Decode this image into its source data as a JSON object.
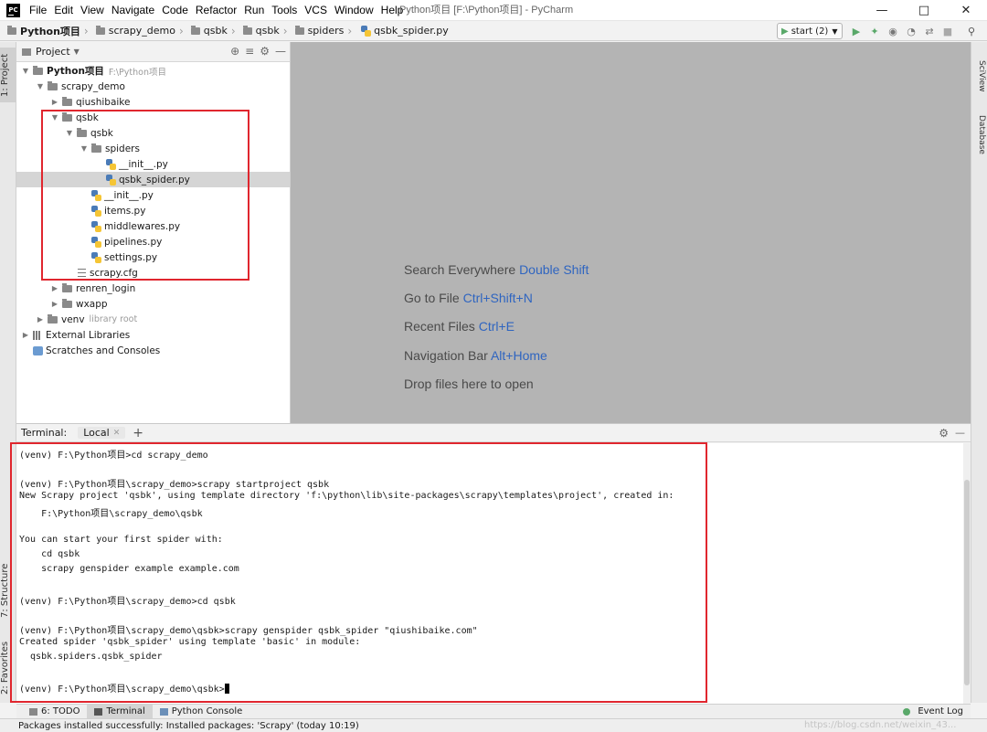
{
  "titlebar": {
    "app_icon": "PC",
    "menu": [
      "File",
      "Edit",
      "View",
      "Navigate",
      "Code",
      "Refactor",
      "Run",
      "Tools",
      "VCS",
      "Window",
      "Help"
    ],
    "title": "Python项目 [F:\\Python项目] - PyCharm",
    "controls": [
      "minimize-icon",
      "maximize-icon",
      "close-icon"
    ]
  },
  "navbar": {
    "breadcrumbs": [
      "Python项目",
      "scrapy_demo",
      "qsbk",
      "qsbk",
      "spiders",
      "qsbk_spider.py"
    ],
    "run_config": "start (2)",
    "run_icons": [
      "run-icon",
      "debug-icon",
      "coverage-icon",
      "profile-icon",
      "concurrency-icon",
      "stop-icon",
      "search-icon"
    ]
  },
  "left_strip": {
    "project_tab": "1: Project",
    "structure_tab": "7: Structure",
    "favorites_tab": "2: Favorites"
  },
  "right_strip": {
    "sciview_tab": "SciView",
    "database_tab": "Database"
  },
  "project_panel": {
    "header": "Project",
    "tree": [
      {
        "name": "Python项目",
        "note": "F:\\Python项目",
        "indent": 0,
        "type": "folder",
        "arrow": "down",
        "bold": true
      },
      {
        "name": "scrapy_demo",
        "indent": 1,
        "type": "folder",
        "arrow": "down"
      },
      {
        "name": "qiushibaike",
        "indent": 2,
        "type": "folder",
        "arrow": "right"
      },
      {
        "name": "qsbk",
        "indent": 2,
        "type": "folder",
        "arrow": "down"
      },
      {
        "name": "qsbk",
        "indent": 3,
        "type": "folder",
        "arrow": "down"
      },
      {
        "name": "spiders",
        "indent": 4,
        "type": "folder",
        "arrow": "down"
      },
      {
        "name": "__init__.py",
        "indent": 5,
        "type": "py"
      },
      {
        "name": "qsbk_spider.py",
        "indent": 5,
        "type": "py",
        "selected": true
      },
      {
        "name": "__init__.py",
        "indent": 4,
        "type": "py"
      },
      {
        "name": "items.py",
        "indent": 4,
        "type": "py"
      },
      {
        "name": "middlewares.py",
        "indent": 4,
        "type": "py"
      },
      {
        "name": "pipelines.py",
        "indent": 4,
        "type": "py"
      },
      {
        "name": "settings.py",
        "indent": 4,
        "type": "py"
      },
      {
        "name": "scrapy.cfg",
        "indent": 3,
        "type": "cfg"
      },
      {
        "name": "renren_login",
        "indent": 2,
        "type": "folder",
        "arrow": "right"
      },
      {
        "name": "wxapp",
        "indent": 2,
        "type": "folder",
        "arrow": "right"
      },
      {
        "name": "venv",
        "note": "library root",
        "indent": 1,
        "type": "folder",
        "arrow": "right"
      },
      {
        "name": "External Libraries",
        "indent": 0,
        "type": "lib",
        "arrow": "right"
      },
      {
        "name": "Scratches and Consoles",
        "indent": 0,
        "type": "scratch"
      }
    ]
  },
  "editor_hints": [
    {
      "label": "Search Everywhere",
      "key": "Double Shift"
    },
    {
      "label": "Go to File",
      "key": "Ctrl+Shift+N"
    },
    {
      "label": "Recent Files",
      "key": "Ctrl+E"
    },
    {
      "label": "Navigation Bar",
      "key": "Alt+Home"
    },
    {
      "label": "Drop files here to open",
      "key": ""
    }
  ],
  "terminal": {
    "header_label": "Terminal:",
    "tab": "Local",
    "add": "+",
    "lines": [
      "(venv) F:\\Python项目>cd scrapy_demo",
      "",
      "(venv) F:\\Python项目\\scrapy_demo>scrapy startproject qsbk",
      "New Scrapy project 'qsbk', using template directory 'f:\\python\\lib\\site-packages\\scrapy\\templates\\project', created in:",
      "    F:\\Python项目\\scrapy_demo\\qsbk",
      "",
      "You can start your first spider with:",
      "    cd qsbk",
      "    scrapy genspider example example.com",
      "",
      "(venv) F:\\Python项目\\scrapy_demo>cd qsbk",
      "",
      "(venv) F:\\Python项目\\scrapy_demo\\qsbk>scrapy genspider qsbk_spider \"qiushibaike.com\"",
      "Created spider 'qsbk_spider' using template 'basic' in module:",
      "  qsbk.spiders.qsbk_spider",
      "",
      "(venv) F:\\Python项目\\scrapy_demo\\qsbk>"
    ]
  },
  "bottom_tabs": {
    "todo": "6: TODO",
    "terminal": "Terminal",
    "python_console": "Python Console",
    "event_log": "Event Log"
  },
  "status": {
    "message": "Packages installed successfully: Installed packages: 'Scrapy' (today 10:19)",
    "watermark": "https://blog.csdn.net/weixin_43..."
  },
  "colors": {
    "highlight_box": "#e0262e",
    "shortcut_key": "#2f65c0",
    "editor_bg": "#b4b4b4"
  }
}
